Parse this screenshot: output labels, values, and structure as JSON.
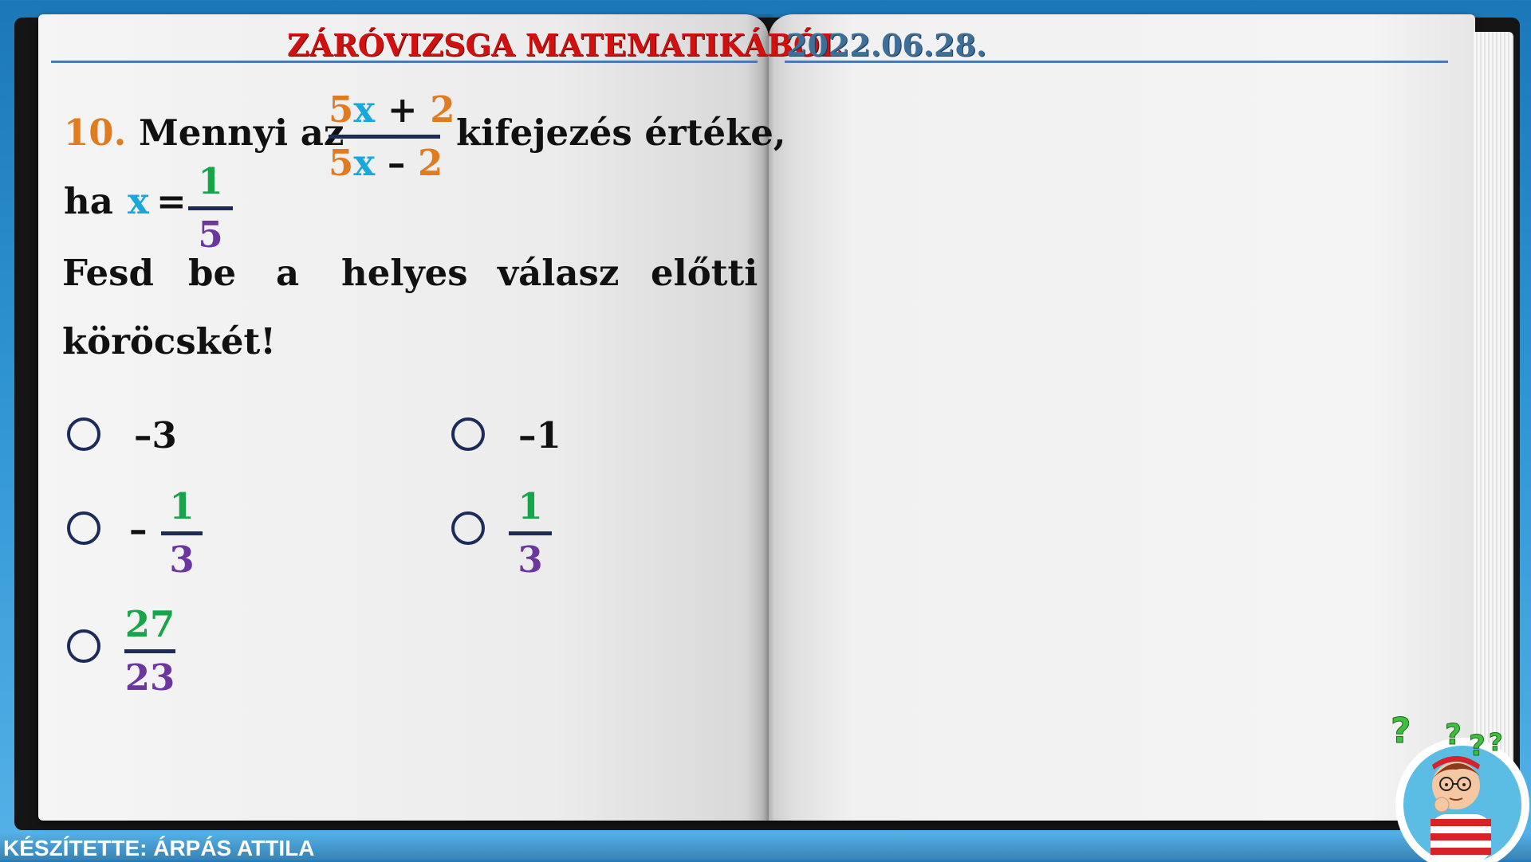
{
  "header": {
    "title": "ZÁRÓVIZSGA MATEMATIKÁBÓL",
    "date": "2022.06.28."
  },
  "question": {
    "number": "10.",
    "text_before": "Mennyi az",
    "expression": {
      "numerator": {
        "coef": "5",
        "var": "x",
        "op": " + ",
        "const": "2"
      },
      "denominator": {
        "coef": "5",
        "var": "x",
        "op": " – ",
        "const": "2"
      }
    },
    "text_after": "kifejezés értéke,",
    "condition_prefix": "ha",
    "variable": "x",
    "equals": "=",
    "value": {
      "numerator": "1",
      "denominator": "5"
    },
    "instruction_words": [
      "Fesd",
      "be",
      "a",
      "helyes",
      "válasz",
      "előtti"
    ],
    "instruction_line2": "köröcskét!"
  },
  "options": [
    {
      "id": "a",
      "text": "–3"
    },
    {
      "id": "b",
      "text": "–1"
    },
    {
      "id": "c",
      "sign": "–",
      "numerator": "1",
      "denominator": "3"
    },
    {
      "id": "d",
      "numerator": "1",
      "denominator": "3"
    },
    {
      "id": "e",
      "numerator": "27",
      "denominator": "23"
    }
  ],
  "footer": {
    "credit": "KÉSZÍTETTE: ÁRPÁS ATTILA"
  },
  "colors": {
    "title": "#d11010",
    "date": "#3d6f98",
    "number": "#e07b1f",
    "variable": "#1aa7dc",
    "fraction_numerator": "#17a54a",
    "fraction_denominator": "#6b36a0",
    "radio": "#1d2b5a"
  },
  "icons": {
    "mascot": "thinking-boy-icon",
    "option_marker": "radio-circle-icon"
  }
}
